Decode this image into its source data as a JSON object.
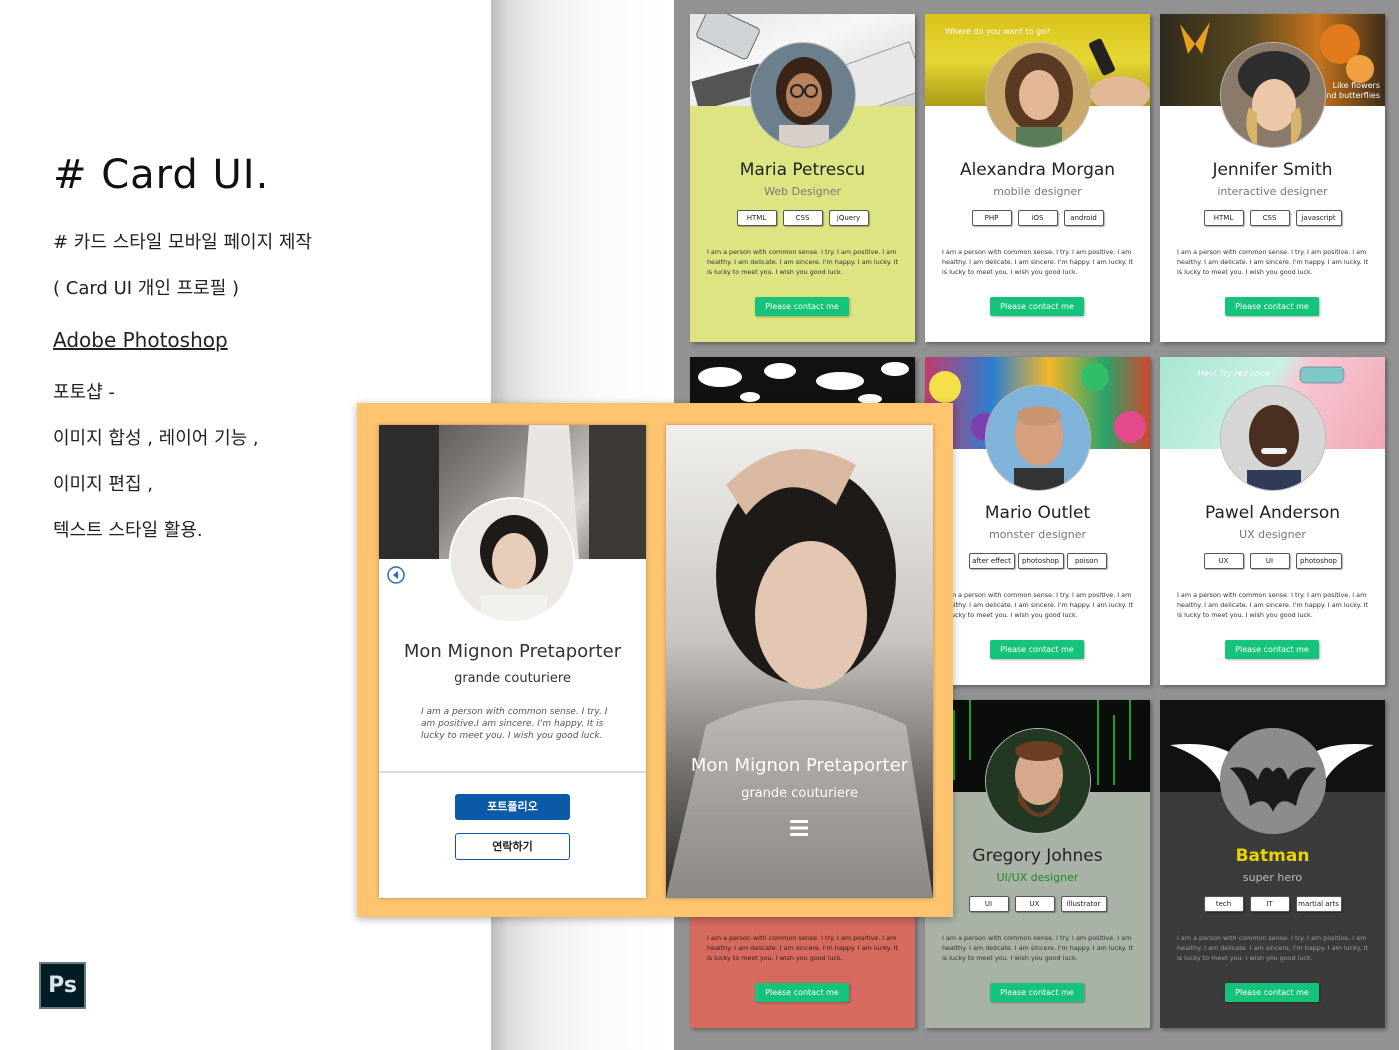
{
  "left": {
    "title": "# Card UI.",
    "subtitle": "# 카드 스타일 모바일 페이지 제작",
    "subtitle2": "( Card UI 개인 프로필 )",
    "tool": "Adobe Photoshop",
    "line1": "포토샵 -",
    "line2": "이미지 합성 , 레이어 기능 ,",
    "line3": "이미지 편집 ,",
    "line4": "텍스트 스타일 활용.",
    "ps_logo": "Ps"
  },
  "description": "I am a person with common sense. I try. I am positive. I am healthy. I am delicate. I am sincere. I'm happy. I am lucky. It is lucky to meet you. I wish you good luck.",
  "button_label": "Please contact me",
  "cards": [
    {
      "name": "Maria Petrescu",
      "role": "Web Designer",
      "tags": [
        "HTML",
        "CSS",
        "jQuery"
      ],
      "bg": "#dde582",
      "top_text": ""
    },
    {
      "name": "Alexandra Morgan",
      "role": "mobile designer",
      "tags": [
        "PHP",
        "iOS",
        "android"
      ],
      "bg": "#ffffff",
      "top_text": "Where do you want to go?"
    },
    {
      "name": "Jennifer Smith",
      "role": "interactive designer",
      "tags": [
        "HTML",
        "CSS",
        "javascript"
      ],
      "bg": "#ffffff",
      "top_text": "Like flowers and butterflies"
    },
    {
      "name": "Mario Outlet",
      "role": "monster designer",
      "tags": [
        "after effect",
        "photoshop",
        "poison"
      ],
      "bg": "#ffffff",
      "top_text": ""
    },
    {
      "name": "Pawel Anderson",
      "role": "UX designer",
      "tags": [
        "UX",
        "UI",
        "photoshop"
      ],
      "bg": "#ffffff",
      "top_text": "Hey! Try red once"
    },
    {
      "name": "Gregory Johnes",
      "role": "UI/UX designer",
      "tags": [
        "UI",
        "UX",
        "illustrator"
      ],
      "bg": "#a8b3a6",
      "top_text": ""
    },
    {
      "name": "Batman",
      "role": "super hero",
      "tags": [
        "tech",
        "IT",
        "martial arts"
      ],
      "bg": "#3b3b3b",
      "top_text": ""
    }
  ],
  "phone1": {
    "name": "Mon Mignon Pretaporter",
    "role": "grande couturiere",
    "desc": "I am a person with common sense. I try. I am positive.I am sincere. I'm happy. It is lucky to meet you. I wish you good luck.",
    "btn_portfolio": "포트폴리오",
    "btn_contact": "연락하기"
  },
  "phone2": {
    "name": "Mon Mignon Pretaporter",
    "role": "grande couturiere"
  },
  "colors": {
    "board": "#929292",
    "orange": "#ffc470",
    "contact_green": "#16c37b",
    "portfolio_blue": "#0b5aa8",
    "batman_yellow": "#e8d400",
    "gregory_green": "#1f8a1f"
  }
}
